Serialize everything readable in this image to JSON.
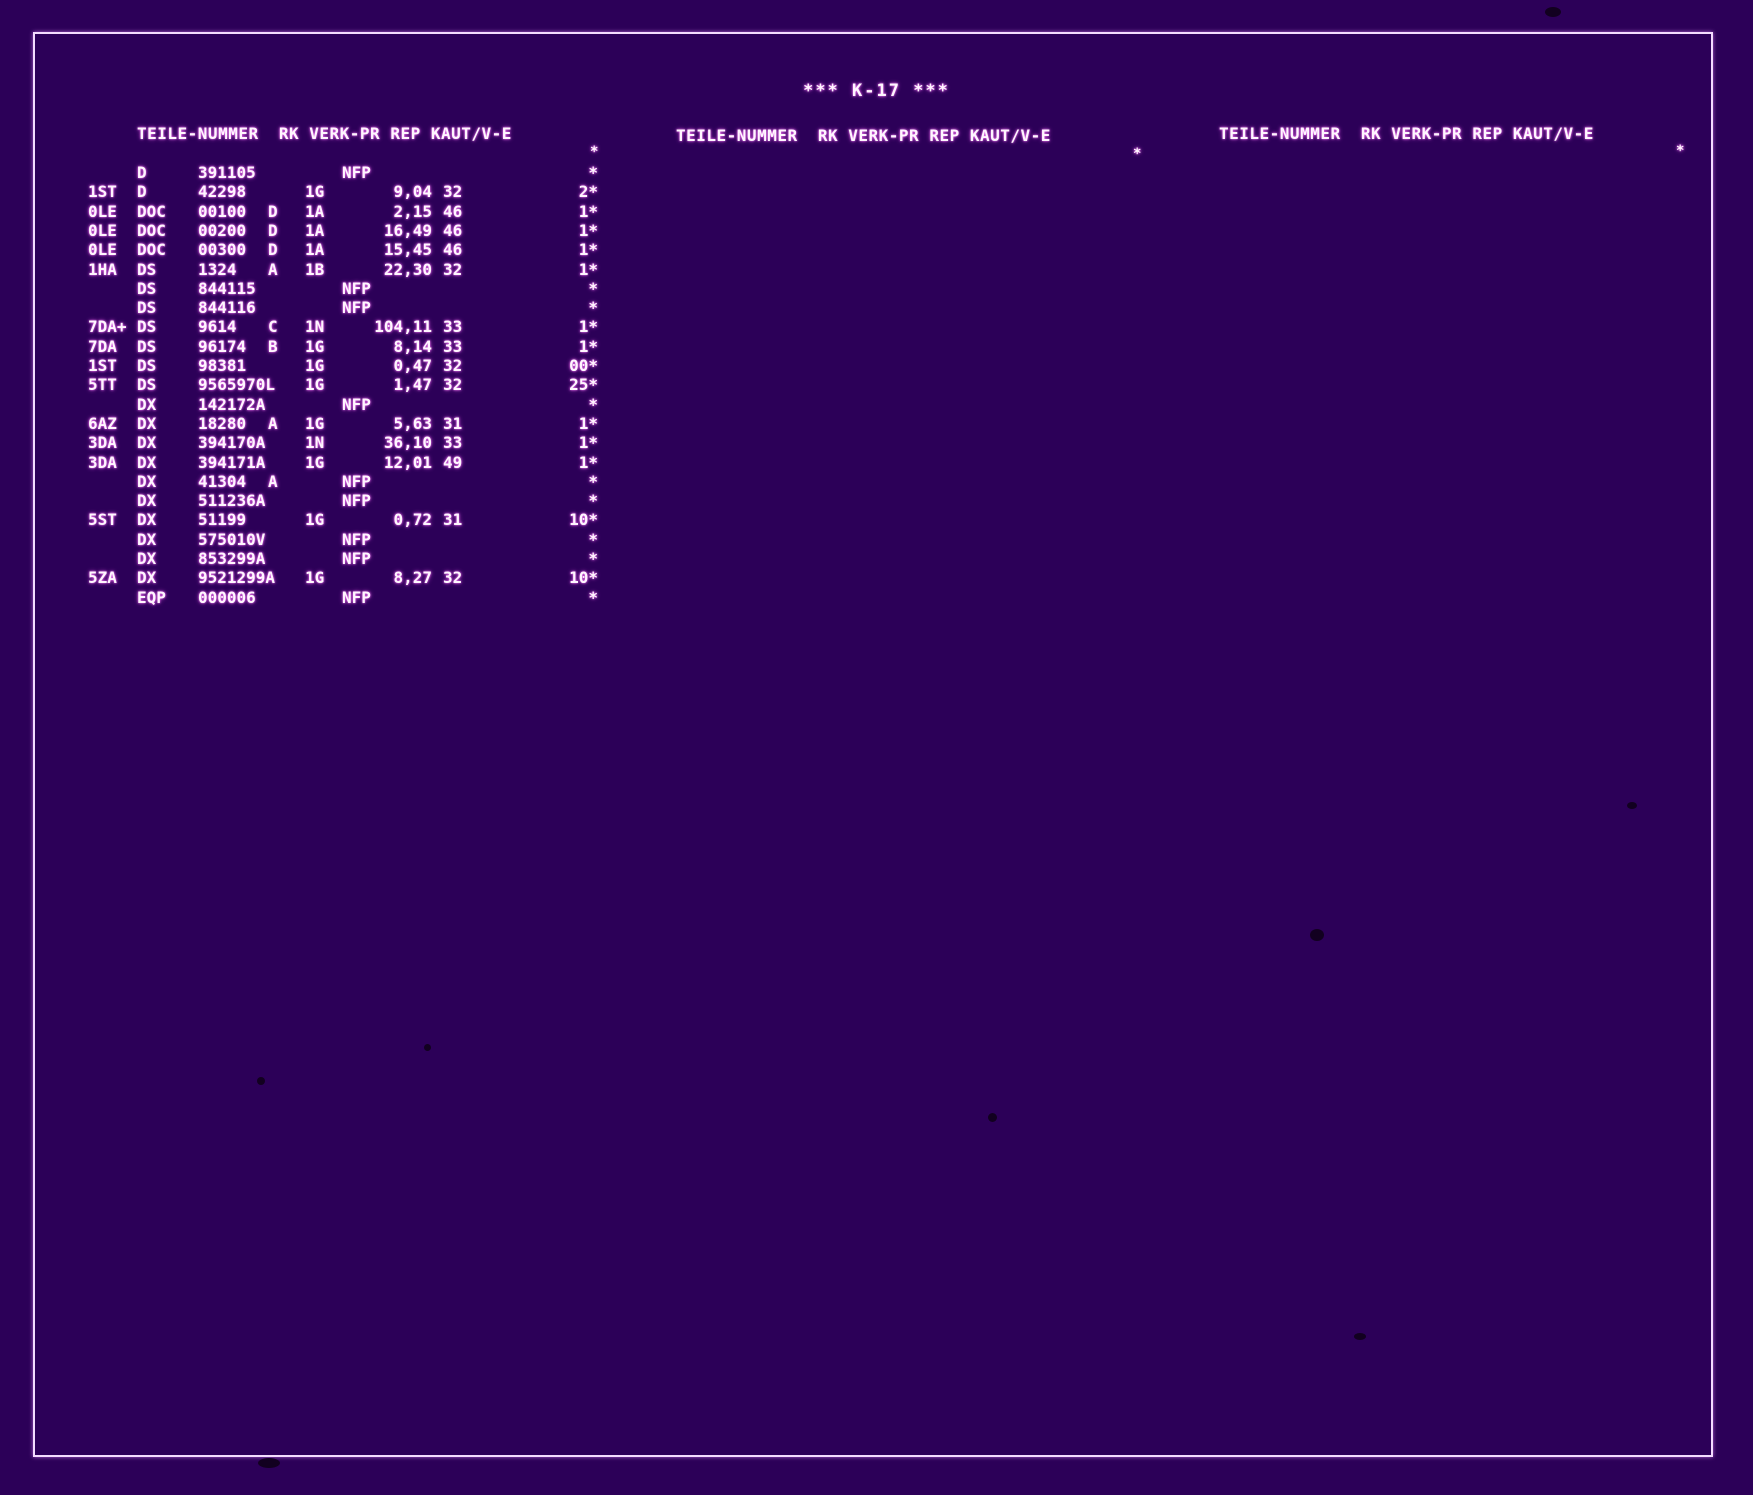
{
  "title": "*** K-17 ***",
  "header_blocks": [
    "TEILE-NUMMER  RK VERK-PR REP KAUT/V-E",
    "TEILE-NUMMER  RK VERK-PR REP KAUT/V-E",
    "TEILE-NUMMER  RK VERK-PR REP KAUT/V-E"
  ],
  "marker": "*",
  "rows": [
    {
      "prefix": "",
      "type": "D",
      "num": "391105",
      "suffix": "",
      "rk": "",
      "price": "",
      "nfp": "NFP",
      "rep": "",
      "kaut": "*"
    },
    {
      "prefix": "1ST",
      "type": "D",
      "num": "42298",
      "suffix": "",
      "rk": "1G",
      "price": "9,04",
      "nfp": "",
      "rep": "32",
      "kaut": "2*"
    },
    {
      "prefix": "0LE",
      "type": "DOC",
      "num": "00100",
      "suffix": "D",
      "rk": "1A",
      "price": "2,15",
      "nfp": "",
      "rep": "46",
      "kaut": "1*"
    },
    {
      "prefix": "0LE",
      "type": "DOC",
      "num": "00200",
      "suffix": "D",
      "rk": "1A",
      "price": "16,49",
      "nfp": "",
      "rep": "46",
      "kaut": "1*"
    },
    {
      "prefix": "0LE",
      "type": "DOC",
      "num": "00300",
      "suffix": "D",
      "rk": "1A",
      "price": "15,45",
      "nfp": "",
      "rep": "46",
      "kaut": "1*"
    },
    {
      "prefix": "1HA",
      "type": "DS",
      "num": "1324",
      "suffix": "A",
      "rk": "1B",
      "price": "22,30",
      "nfp": "",
      "rep": "32",
      "kaut": "1*"
    },
    {
      "prefix": "",
      "type": "DS",
      "num": "844115",
      "suffix": "",
      "rk": "",
      "price": "",
      "nfp": "NFP",
      "rep": "",
      "kaut": "*"
    },
    {
      "prefix": "",
      "type": "DS",
      "num": "844116",
      "suffix": "",
      "rk": "",
      "price": "",
      "nfp": "NFP",
      "rep": "",
      "kaut": "*"
    },
    {
      "prefix": "7DA+",
      "type": "DS",
      "num": "9614",
      "suffix": "C",
      "rk": "1N",
      "price": "104,11",
      "nfp": "",
      "rep": "33",
      "kaut": "1*"
    },
    {
      "prefix": "7DA",
      "type": "DS",
      "num": "96174",
      "suffix": "B",
      "rk": "1G",
      "price": "8,14",
      "nfp": "",
      "rep": "33",
      "kaut": "1*"
    },
    {
      "prefix": "1ST",
      "type": "DS",
      "num": "98381",
      "suffix": "",
      "rk": "1G",
      "price": "0,47",
      "nfp": "",
      "rep": "32",
      "kaut": "00*"
    },
    {
      "prefix": "5TT",
      "type": "DS",
      "num": "9565970L",
      "suffix": "",
      "rk": "1G",
      "price": "1,47",
      "nfp": "",
      "rep": "32",
      "kaut": "25*"
    },
    {
      "prefix": "",
      "type": "DX",
      "num": "142172A",
      "suffix": "",
      "rk": "",
      "price": "",
      "nfp": "NFP",
      "rep": "",
      "kaut": "*"
    },
    {
      "prefix": "6AZ",
      "type": "DX",
      "num": "18280",
      "suffix": "A",
      "rk": "1G",
      "price": "5,63",
      "nfp": "",
      "rep": "31",
      "kaut": "1*"
    },
    {
      "prefix": "3DA",
      "type": "DX",
      "num": "394170A",
      "suffix": "",
      "rk": "1N",
      "price": "36,10",
      "nfp": "",
      "rep": "33",
      "kaut": "1*"
    },
    {
      "prefix": "3DA",
      "type": "DX",
      "num": "394171A",
      "suffix": "",
      "rk": "1G",
      "price": "12,01",
      "nfp": "",
      "rep": "49",
      "kaut": "1*"
    },
    {
      "prefix": "",
      "type": "DX",
      "num": "41304",
      "suffix": "A",
      "rk": "",
      "price": "",
      "nfp": "NFP",
      "rep": "",
      "kaut": "*"
    },
    {
      "prefix": "",
      "type": "DX",
      "num": "511236A",
      "suffix": "",
      "rk": "",
      "price": "",
      "nfp": "NFP",
      "rep": "",
      "kaut": "*"
    },
    {
      "prefix": "5ST",
      "type": "DX",
      "num": "51199",
      "suffix": "",
      "rk": "1G",
      "price": "0,72",
      "nfp": "",
      "rep": "31",
      "kaut": "10*"
    },
    {
      "prefix": "",
      "type": "DX",
      "num": "575010V",
      "suffix": "",
      "rk": "",
      "price": "",
      "nfp": "NFP",
      "rep": "",
      "kaut": "*"
    },
    {
      "prefix": "",
      "type": "DX",
      "num": "853299A",
      "suffix": "",
      "rk": "",
      "price": "",
      "nfp": "NFP",
      "rep": "",
      "kaut": "*"
    },
    {
      "prefix": "5ZA",
      "type": "DX",
      "num": "9521299A",
      "suffix": "",
      "rk": "1G",
      "price": "8,27",
      "nfp": "",
      "rep": "32",
      "kaut": "10*"
    },
    {
      "prefix": "",
      "type": "EQP",
      "num": "000006",
      "suffix": "",
      "rk": "",
      "price": "",
      "nfp": "NFP",
      "rep": "",
      "kaut": "*"
    }
  ]
}
